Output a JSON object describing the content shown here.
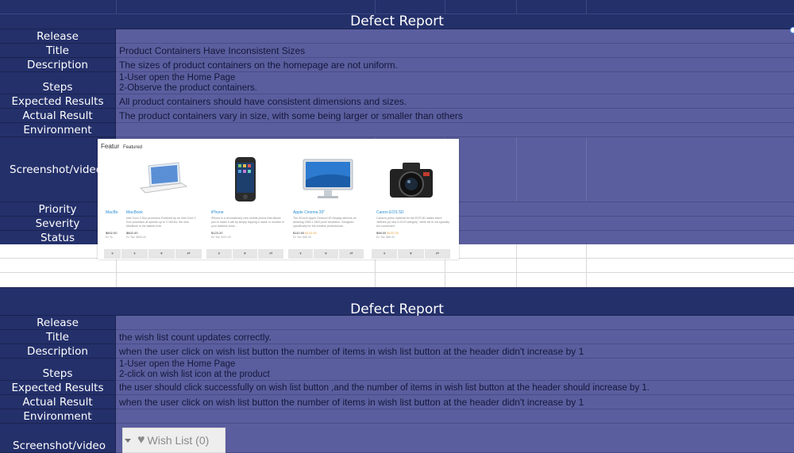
{
  "report1": {
    "title": "Defect Report",
    "labels": {
      "release": "Release",
      "title": "Title",
      "description": "Description",
      "steps": "Steps",
      "expected": "Expected Results",
      "actual": "Actual Result",
      "environment": "Environment",
      "screenshot": "Screenshot/video",
      "priority": "Priority",
      "severity": "Severity",
      "status": "Status"
    },
    "values": {
      "release": "",
      "title": "Product Containers Have Inconsistent Sizes",
      "description": "The sizes of product containers on the homepage are not uniform.",
      "steps_1": "1-User open the Home Page",
      "steps_2": "2-Observe the product containers.",
      "expected": "All product containers should have consistent dimensions and sizes.",
      "actual": "The product containers vary in size, with some being larger or smaller than others",
      "environment": "",
      "priority": "",
      "severity": "",
      "status": ""
    },
    "screenshot": {
      "heading_back": "Featur",
      "heading_front": "Featured",
      "products": [
        {
          "name": "MacBook",
          "desc": "Intel Core 2 Duo processor Powered by an Intel Core 2 Duo processor at speeds up to 2.16GHz, the new MacBook is the fastest ever.",
          "price": "$602.00",
          "old": "",
          "tax": "Ex Tax: $500.00",
          "icon": "laptop-icon"
        },
        {
          "name": "iPhone",
          "desc": "iPhone is a revolutionary new mobile phone that allows you to make a call by simply tapping a name or number in your address book...",
          "price": "$123.20",
          "old": "",
          "tax": "Ex Tax: $101.00",
          "icon": "phone-icon"
        },
        {
          "name": "Apple Cinema 30\"",
          "desc": "The 30-inch Apple Cinema HD Display delivers an amazing 2560 x 1600 pixel resolution. Designed specifically for the creative professional...",
          "price": "$110.00",
          "old": "$122.00",
          "tax": "Ex Tax: $90.00",
          "icon": "monitor-icon"
        },
        {
          "name": "Canon EOS 5D",
          "desc": "Canon's press material for the EOS 5D states that it 'defines (a) new D-SLR category', while we're not typically too concerned...",
          "price": "$98.00",
          "old": "$122.00",
          "tax": "Ex Tax: $80.00",
          "icon": "camera-icon"
        }
      ],
      "partial_name": "MacBo",
      "partial_price": "$602.00",
      "partial_tax": "Ex Ta"
    }
  },
  "report2": {
    "title": "Defect Report",
    "labels": {
      "release": "Release",
      "title": "Title",
      "description": "Description",
      "steps": "Steps",
      "expected": "Expected Results",
      "actual": "Actual Result",
      "environment": "Environment",
      "screenshot": "Screenshot/video"
    },
    "values": {
      "release": "",
      "title": " the wish list count updates correctly.",
      "description": "when the user click on wish list button  the number of items in wish list button at the header didn't increase by 1",
      "steps_1": "1-User open the Home Page",
      "steps_2": "2-click on wish list icon at the product",
      "expected": "the user should click successfully on wish list button ,and the number of items in wish list button at the header should increase by 1.",
      "actual": "when the user click on wish list button  the number of items in wish list button at the header didn't increase by 1",
      "environment": ""
    },
    "wish_button": "Wish List (0)"
  },
  "colors": {
    "header_bg": "#24306a",
    "value_bg": "#5b5e9e",
    "text_dark": "#14183a",
    "link_blue": "#2a8fd4"
  }
}
